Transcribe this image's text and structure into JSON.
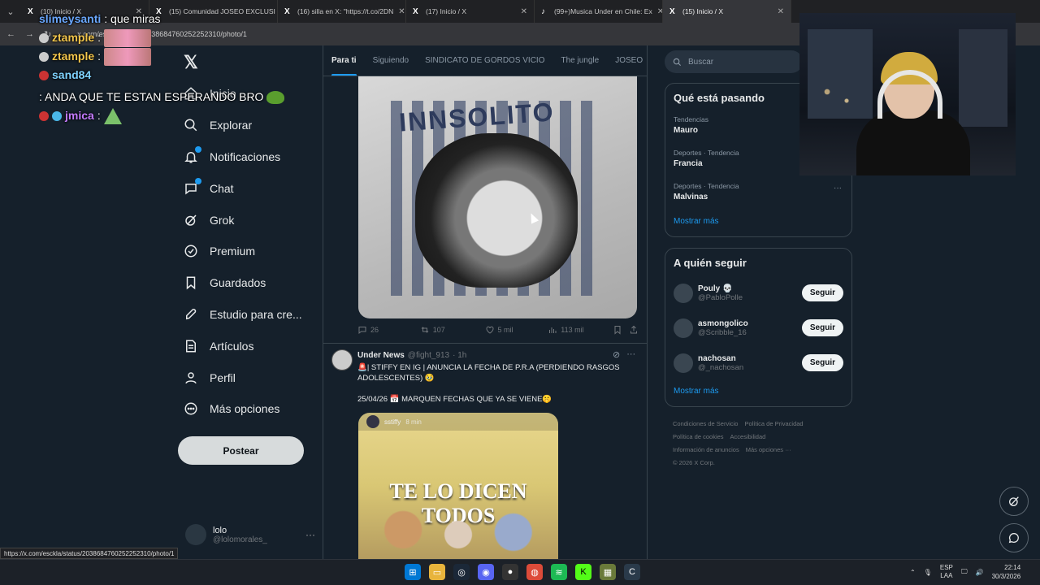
{
  "browser": {
    "tabs": [
      {
        "title": "(10) Inicio / X",
        "active": false
      },
      {
        "title": "(15) Comunidad JOSEO EXCLUSI",
        "active": false
      },
      {
        "title": "(16) silla en X: \"https://t.co/2DN",
        "active": false
      },
      {
        "title": "(17) Inicio / X",
        "active": false
      },
      {
        "title": "(99+)Musica Under en Chile: Ex",
        "active": false
      },
      {
        "title": "(15) Inicio / X",
        "active": true
      }
    ],
    "url": "x.com/esckla/status/2038684760252252310/photo/1",
    "status_url": "https://x.com/esckla/status/2038684760252252310/photo/1"
  },
  "chat_overlay": [
    {
      "user": "slimeysanti",
      "message": ": que miras",
      "color": "#6aa8ff"
    },
    {
      "user": "ztample",
      "message": ":",
      "color": "#f3c64c"
    },
    {
      "user": "ztample",
      "message": ":",
      "color": "#f3c64c"
    },
    {
      "user": "sand84",
      "message": ": ANDA QUE TE ESTAN ESPERANDO BRO",
      "color": "#7fd3ff"
    },
    {
      "user": "jmica",
      "message": ":",
      "color": "#c47bff"
    }
  ],
  "nav": {
    "items": [
      {
        "label": "Inicio",
        "icon": "home-icon"
      },
      {
        "label": "Explorar",
        "icon": "search-icon"
      },
      {
        "label": "Notificaciones",
        "icon": "bell-icon"
      },
      {
        "label": "Chat",
        "icon": "chat-icon"
      },
      {
        "label": "Grok",
        "icon": "grok-icon"
      },
      {
        "label": "Premium",
        "icon": "premium-icon"
      },
      {
        "label": "Guardados",
        "icon": "bookmark-icon"
      },
      {
        "label": "Estudio para cre...",
        "icon": "rocket-icon"
      },
      {
        "label": "Artículos",
        "icon": "article-icon"
      },
      {
        "label": "Perfil",
        "icon": "person-icon"
      },
      {
        "label": "Más opciones",
        "icon": "more-icon"
      }
    ],
    "post_label": "Postear",
    "account": {
      "name": "lolo",
      "handle": "@lolomorales_"
    }
  },
  "feed": {
    "tabs": [
      "Para ti",
      "Siguiendo",
      "SINDICATO DE GORDOS VICIO",
      "The jungle",
      "JOSEO"
    ],
    "photo_brand": "INNSOLITO",
    "actions": {
      "replies": "26",
      "reposts": "107",
      "likes": "5 mil",
      "views": "113 mil"
    },
    "tweet": {
      "name": "Under News",
      "handle": "@fight_913",
      "time": "· 1h",
      "text": "🚨| STIFFY EN IG | ANUNCIA LA FECHA DE P.R.A (PERDIENDO RASGOS ADOLESCENTES) 🥹",
      "text2": "25/04/26 📅 MARQUEN FECHAS QUE YA SE VIENE🤫",
      "media_user": "sstiffy",
      "media_time": "8 min",
      "media_caption": "TE LO DICEN TODOS"
    }
  },
  "sidebar": {
    "search_placeholder": "Buscar",
    "trends_title": "Qué está pasando",
    "trends": [
      {
        "category": "Tendencias",
        "name": "Mauro"
      },
      {
        "category": "Deportes · Tendencia",
        "name": "Francia"
      },
      {
        "category": "Deportes · Tendencia",
        "name": "Malvinas"
      }
    ],
    "show_more": "Mostrar más",
    "follow_title": "A quién seguir",
    "follow": [
      {
        "name": "Pouly 💀",
        "handle": "@PabloPolle",
        "button": "Seguir"
      },
      {
        "name": "asmongolico",
        "handle": "@Scribble_16",
        "button": "Seguir"
      },
      {
        "name": "nachosan",
        "handle": "@_nachosan",
        "button": "Seguir"
      }
    ],
    "footer": [
      "Condiciones de Servicio",
      "Política de Privacidad",
      "Política de cookies",
      "Accesibilidad",
      "Información de anuncios",
      "Más opciones ···",
      "© 2026 X Corp."
    ]
  },
  "taskbar": {
    "lang_top": "ESP",
    "lang_bottom": "LAA",
    "time": "22:14",
    "date": "30/3/2026"
  },
  "colors": {
    "accent": "#1d9bf0",
    "bg": "#15202b"
  }
}
